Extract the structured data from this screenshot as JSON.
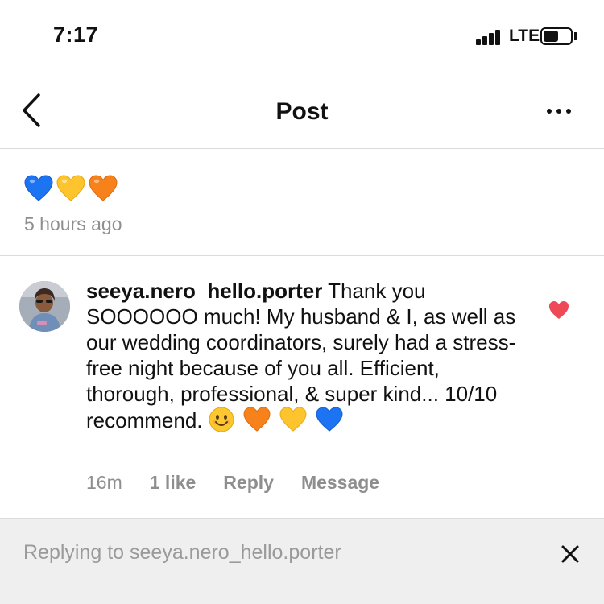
{
  "status_bar": {
    "time": "7:17",
    "network": "LTE",
    "battery_level": 0.55
  },
  "header": {
    "title": "Post",
    "back_icon": "chevron-left-icon",
    "more_icon": "more-horizontal-icon"
  },
  "caption": {
    "emojis": [
      "blue-heart",
      "yellow-heart",
      "orange-heart"
    ],
    "timestamp": "5 hours ago"
  },
  "comment": {
    "username": "seeya.nero_hello.porter",
    "text": "Thank you SOOOOOO much! My husband & I, as well as our wedding coordinators, surely had a stress-free night because of you all. Efficient, thorough, professional, & super kind... 10/10 recommend.",
    "trailing_emojis": [
      "smiling-face",
      "orange-heart",
      "yellow-heart",
      "blue-heart"
    ],
    "time": "16m",
    "likes": "1 like",
    "reply_label": "Reply",
    "message_label": "Message",
    "liked": true
  },
  "reply_bar": {
    "text": "Replying to seeya.nero_hello.porter",
    "close_icon": "close-icon"
  },
  "colors": {
    "blue_heart": "#1d74f2",
    "yellow_heart": "#fdc42e",
    "orange_heart": "#f7821b",
    "like_heart": "#ed4956",
    "secondary_text": "#8e8e8e",
    "divider": "#dbdbdb",
    "reply_bar_bg": "#efefef"
  }
}
